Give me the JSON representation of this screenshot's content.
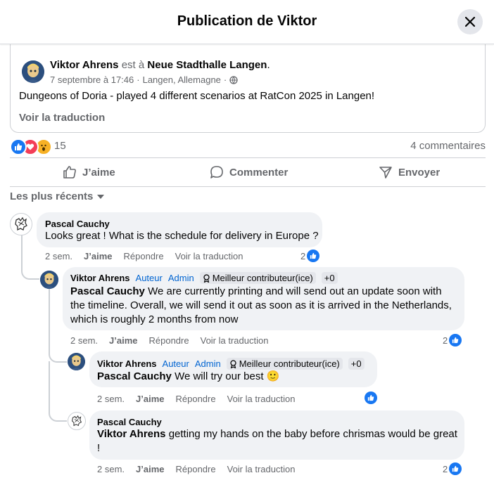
{
  "modal": {
    "title": "Publication de Viktor"
  },
  "post": {
    "author": "Viktor Ahrens",
    "location_prefix": "est à",
    "location": "Neue Stadthalle Langen",
    "period": ".",
    "date": "7 septembre à 17:46",
    "place": "Langen, Allemagne",
    "separator": "·",
    "text": "Dungeons of Doria - played 4 different scenarios at RatCon 2025 in Langen!",
    "see_translation": "Voir la traduction",
    "reactions_count": "15",
    "comments_count": "4 commentaires",
    "reaction_icons": [
      "like-icon",
      "love-icon",
      "wow-icon"
    ]
  },
  "actions": {
    "like": "J’aime",
    "comment": "Commenter",
    "send": "Envoyer"
  },
  "sort": {
    "label": "Les plus récents"
  },
  "badges": {
    "author": "Auteur",
    "admin": "Admin",
    "top_contributor": "Meilleur contributeur(ice)",
    "plus": "+0"
  },
  "comment_actions": {
    "like": "J’aime",
    "reply": "Répondre",
    "translate": "Voir la traduction"
  },
  "comments": [
    {
      "name": "Pascal Cauchy",
      "mention": "",
      "text": "Looks great ! What is the schedule for delivery in Europe ?",
      "time": "2 sem.",
      "likes": "2"
    },
    {
      "name": "Viktor Ahrens",
      "mention": "Pascal Cauchy",
      "text": " We are currently printing and will send out an update soon with the timeline. Overall, we will send it out as soon as it is arrived in the Netherlands, which is roughly 2 months from now",
      "time": "2 sem.",
      "likes": "2"
    },
    {
      "name": "Viktor Ahrens",
      "mention": "Pascal Cauchy",
      "text": " We will try our best 🙂",
      "time": "2 sem.",
      "likes": ""
    },
    {
      "name": "Pascal Cauchy",
      "mention": "Viktor Ahrens",
      "text": " getting my hands on the baby before chrismas would be great !",
      "time": "2 sem.",
      "likes": "2"
    }
  ],
  "colors": {
    "accent": "#1877f2",
    "bubble": "#f0f2f5",
    "muted": "#65676b",
    "badge_blue": "#0064d1"
  }
}
